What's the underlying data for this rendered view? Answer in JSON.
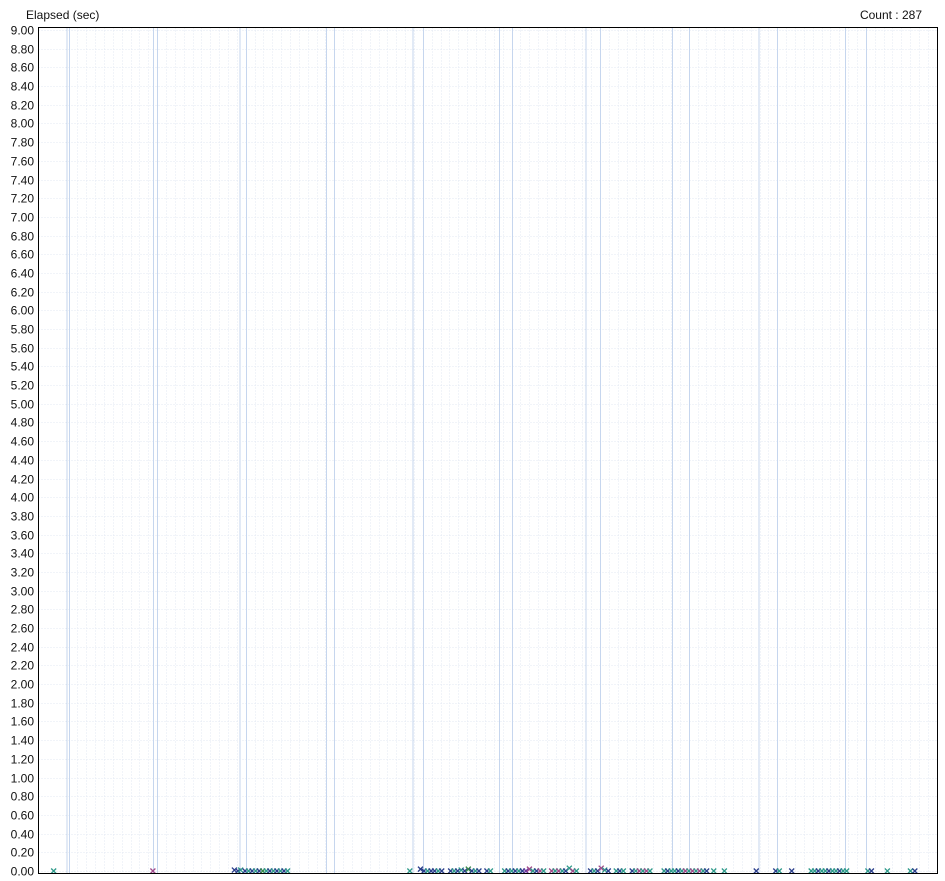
{
  "header": {
    "ylabel": "Elapsed (sec)",
    "count_label": "Count : 287"
  },
  "chart_data": {
    "type": "scatter",
    "title": "",
    "ylabel": "Elapsed (sec)",
    "xlabel": "",
    "ylim": [
      0,
      9
    ],
    "ytick_step": 0.2,
    "xlim": [
      0,
      1
    ],
    "grid": true,
    "marker": "x",
    "point_count": 287,
    "point_colors": [
      "#2e9a8a",
      "#2b3f8c",
      "#a04a8a",
      "#3a8a4a",
      "#6a3aa0",
      "#1f8ad0"
    ],
    "colors": {
      "axis": "#000000",
      "major_grid": "#c6d6ee",
      "minor_grid": "#e3e9f3"
    },
    "points": [
      {
        "x": 0.003,
        "y": 0.0,
        "c": 0
      },
      {
        "x": 0.115,
        "y": 0.0,
        "c": 2
      },
      {
        "x": 0.207,
        "y": 0.01,
        "c": 1
      },
      {
        "x": 0.211,
        "y": 0.0,
        "c": 1
      },
      {
        "x": 0.214,
        "y": 0.01,
        "c": 0
      },
      {
        "x": 0.219,
        "y": 0.0,
        "c": 1
      },
      {
        "x": 0.223,
        "y": 0.0,
        "c": 0
      },
      {
        "x": 0.227,
        "y": 0.0,
        "c": 1
      },
      {
        "x": 0.231,
        "y": 0.0,
        "c": 0
      },
      {
        "x": 0.235,
        "y": 0.0,
        "c": 1
      },
      {
        "x": 0.239,
        "y": 0.0,
        "c": 3
      },
      {
        "x": 0.243,
        "y": 0.0,
        "c": 0
      },
      {
        "x": 0.247,
        "y": 0.0,
        "c": 1
      },
      {
        "x": 0.251,
        "y": 0.0,
        "c": 0
      },
      {
        "x": 0.255,
        "y": 0.0,
        "c": 1
      },
      {
        "x": 0.259,
        "y": 0.0,
        "c": 0
      },
      {
        "x": 0.263,
        "y": 0.0,
        "c": 1
      },
      {
        "x": 0.267,
        "y": 0.0,
        "c": 0
      },
      {
        "x": 0.405,
        "y": 0.0,
        "c": 0
      },
      {
        "x": 0.417,
        "y": 0.02,
        "c": 1
      },
      {
        "x": 0.421,
        "y": 0.0,
        "c": 1
      },
      {
        "x": 0.425,
        "y": 0.0,
        "c": 0
      },
      {
        "x": 0.429,
        "y": 0.0,
        "c": 1
      },
      {
        "x": 0.433,
        "y": 0.0,
        "c": 1
      },
      {
        "x": 0.437,
        "y": 0.0,
        "c": 0
      },
      {
        "x": 0.441,
        "y": 0.0,
        "c": 1
      },
      {
        "x": 0.451,
        "y": 0.0,
        "c": 1
      },
      {
        "x": 0.455,
        "y": 0.0,
        "c": 0
      },
      {
        "x": 0.459,
        "y": 0.0,
        "c": 1
      },
      {
        "x": 0.463,
        "y": 0.01,
        "c": 0
      },
      {
        "x": 0.467,
        "y": 0.0,
        "c": 1
      },
      {
        "x": 0.471,
        "y": 0.02,
        "c": 3
      },
      {
        "x": 0.475,
        "y": 0.0,
        "c": 1
      },
      {
        "x": 0.479,
        "y": 0.0,
        "c": 0
      },
      {
        "x": 0.483,
        "y": 0.0,
        "c": 1
      },
      {
        "x": 0.492,
        "y": 0.0,
        "c": 1
      },
      {
        "x": 0.496,
        "y": 0.0,
        "c": 0
      },
      {
        "x": 0.512,
        "y": 0.0,
        "c": 0
      },
      {
        "x": 0.516,
        "y": 0.0,
        "c": 1
      },
      {
        "x": 0.52,
        "y": 0.0,
        "c": 0
      },
      {
        "x": 0.524,
        "y": 0.0,
        "c": 1
      },
      {
        "x": 0.528,
        "y": 0.0,
        "c": 0
      },
      {
        "x": 0.532,
        "y": 0.0,
        "c": 1
      },
      {
        "x": 0.536,
        "y": 0.0,
        "c": 4
      },
      {
        "x": 0.54,
        "y": 0.02,
        "c": 2
      },
      {
        "x": 0.544,
        "y": 0.0,
        "c": 0
      },
      {
        "x": 0.548,
        "y": 0.0,
        "c": 1
      },
      {
        "x": 0.552,
        "y": 0.0,
        "c": 2
      },
      {
        "x": 0.556,
        "y": 0.0,
        "c": 0
      },
      {
        "x": 0.565,
        "y": 0.0,
        "c": 2
      },
      {
        "x": 0.569,
        "y": 0.0,
        "c": 0
      },
      {
        "x": 0.573,
        "y": 0.0,
        "c": 2
      },
      {
        "x": 0.577,
        "y": 0.0,
        "c": 0
      },
      {
        "x": 0.581,
        "y": 0.0,
        "c": 1
      },
      {
        "x": 0.585,
        "y": 0.03,
        "c": 0
      },
      {
        "x": 0.589,
        "y": 0.0,
        "c": 2
      },
      {
        "x": 0.593,
        "y": 0.0,
        "c": 0
      },
      {
        "x": 0.609,
        "y": 0.0,
        "c": 1
      },
      {
        "x": 0.613,
        "y": 0.0,
        "c": 0
      },
      {
        "x": 0.617,
        "y": 0.0,
        "c": 1
      },
      {
        "x": 0.621,
        "y": 0.03,
        "c": 2
      },
      {
        "x": 0.625,
        "y": 0.01,
        "c": 0
      },
      {
        "x": 0.629,
        "y": 0.0,
        "c": 1
      },
      {
        "x": 0.638,
        "y": 0.0,
        "c": 0
      },
      {
        "x": 0.642,
        "y": 0.0,
        "c": 1
      },
      {
        "x": 0.646,
        "y": 0.0,
        "c": 0
      },
      {
        "x": 0.656,
        "y": 0.0,
        "c": 1
      },
      {
        "x": 0.66,
        "y": 0.0,
        "c": 0
      },
      {
        "x": 0.664,
        "y": 0.0,
        "c": 2
      },
      {
        "x": 0.668,
        "y": 0.0,
        "c": 0
      },
      {
        "x": 0.672,
        "y": 0.0,
        "c": 2
      },
      {
        "x": 0.676,
        "y": 0.0,
        "c": 0
      },
      {
        "x": 0.692,
        "y": 0.0,
        "c": 0
      },
      {
        "x": 0.696,
        "y": 0.0,
        "c": 1
      },
      {
        "x": 0.7,
        "y": 0.0,
        "c": 0
      },
      {
        "x": 0.704,
        "y": 0.0,
        "c": 0
      },
      {
        "x": 0.708,
        "y": 0.0,
        "c": 1
      },
      {
        "x": 0.712,
        "y": 0.0,
        "c": 0
      },
      {
        "x": 0.716,
        "y": 0.0,
        "c": 2
      },
      {
        "x": 0.72,
        "y": 0.0,
        "c": 0
      },
      {
        "x": 0.724,
        "y": 0.0,
        "c": 2
      },
      {
        "x": 0.728,
        "y": 0.0,
        "c": 0
      },
      {
        "x": 0.732,
        "y": 0.0,
        "c": 2
      },
      {
        "x": 0.736,
        "y": 0.0,
        "c": 0
      },
      {
        "x": 0.74,
        "y": 0.0,
        "c": 1
      },
      {
        "x": 0.748,
        "y": 0.0,
        "c": 0
      },
      {
        "x": 0.76,
        "y": 0.0,
        "c": 0
      },
      {
        "x": 0.796,
        "y": 0.0,
        "c": 1
      },
      {
        "x": 0.818,
        "y": 0.0,
        "c": 1
      },
      {
        "x": 0.822,
        "y": 0.0,
        "c": 0
      },
      {
        "x": 0.836,
        "y": 0.0,
        "c": 1
      },
      {
        "x": 0.858,
        "y": 0.0,
        "c": 0
      },
      {
        "x": 0.862,
        "y": 0.0,
        "c": 0
      },
      {
        "x": 0.866,
        "y": 0.0,
        "c": 1
      },
      {
        "x": 0.87,
        "y": 0.0,
        "c": 0
      },
      {
        "x": 0.874,
        "y": 0.0,
        "c": 0
      },
      {
        "x": 0.878,
        "y": 0.0,
        "c": 1
      },
      {
        "x": 0.882,
        "y": 0.0,
        "c": 0
      },
      {
        "x": 0.886,
        "y": 0.0,
        "c": 0
      },
      {
        "x": 0.89,
        "y": 0.0,
        "c": 1
      },
      {
        "x": 0.894,
        "y": 0.0,
        "c": 0
      },
      {
        "x": 0.898,
        "y": 0.0,
        "c": 0
      },
      {
        "x": 0.922,
        "y": 0.0,
        "c": 0
      },
      {
        "x": 0.926,
        "y": 0.0,
        "c": 1
      },
      {
        "x": 0.944,
        "y": 0.0,
        "c": 0
      },
      {
        "x": 0.97,
        "y": 0.0,
        "c": 0
      },
      {
        "x": 0.975,
        "y": 0.0,
        "c": 1
      }
    ]
  }
}
